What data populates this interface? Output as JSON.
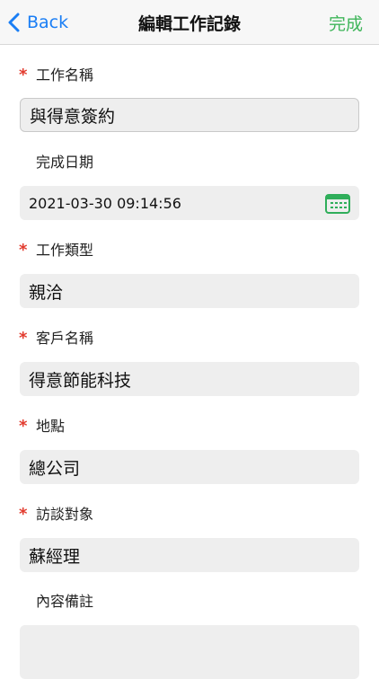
{
  "nav": {
    "back_label": "Back",
    "title": "編輯工作記錄",
    "done_label": "完成"
  },
  "colors": {
    "accent_blue": "#1a7ef5",
    "done_green": "#3fb65a",
    "required_red": "#e23b2e",
    "calendar_green": "#2fae5a"
  },
  "fields": [
    {
      "label": "工作名稱",
      "required": true,
      "value": "與得意簽約"
    },
    {
      "label": "完成日期",
      "required": false,
      "value": "2021-03-30 09:14:56",
      "icon": "calendar-icon"
    },
    {
      "label": "工作類型",
      "required": true,
      "value": "親洽"
    },
    {
      "label": "客戶名稱",
      "required": true,
      "value": "得意節能科技"
    },
    {
      "label": "地點",
      "required": true,
      "value": "總公司"
    },
    {
      "label": "訪談對象",
      "required": true,
      "value": "蘇經理"
    },
    {
      "label": "內容備註",
      "required": false,
      "value": ""
    }
  ],
  "required_mark": "*"
}
